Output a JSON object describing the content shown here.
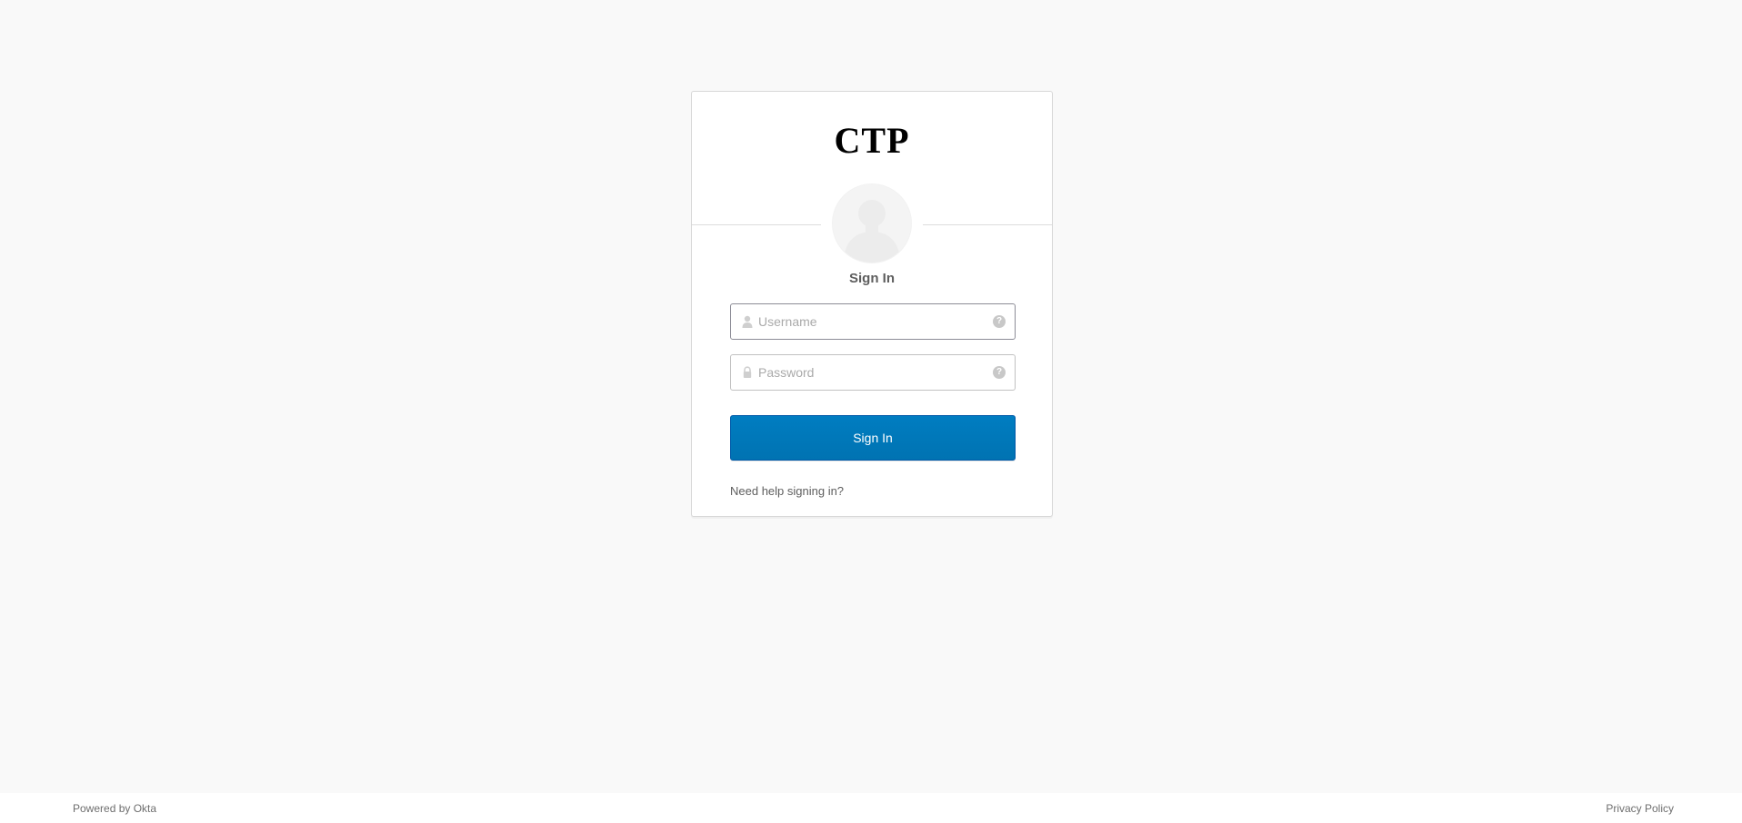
{
  "header": {
    "logo_text": "CTP"
  },
  "form": {
    "title": "Sign In",
    "username": {
      "placeholder": "Username",
      "value": "",
      "icon": "person-icon",
      "help_icon": "question-icon",
      "help_glyph": "?"
    },
    "password": {
      "placeholder": "Password",
      "value": "",
      "icon": "lock-icon",
      "help_icon": "question-icon",
      "help_glyph": "?"
    },
    "submit_label": "Sign In",
    "help_link": "Need help signing in?"
  },
  "footer": {
    "powered_by": "Powered by Okta",
    "privacy": "Privacy Policy"
  },
  "colors": {
    "background": "#f9f9f9",
    "button": "#007dc1",
    "button_text": "#ffffff"
  }
}
